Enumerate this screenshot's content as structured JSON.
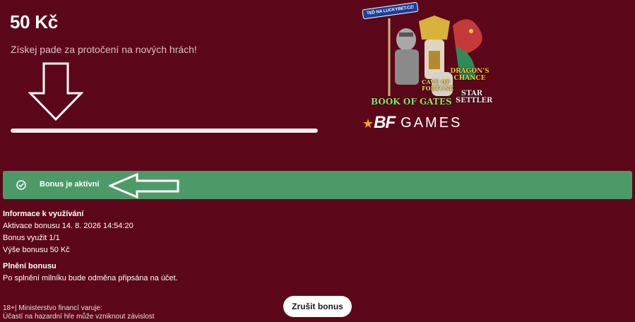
{
  "bonus": {
    "amount": "50 Kč",
    "subtitle": "Získej pade za protočení na nových hrách!",
    "progress_fraction": 1.0
  },
  "promo": {
    "badge": "TEĎ NA LUCKYBET.CZ!",
    "games": [
      "Book of Gates",
      "Cave of Fortune",
      "Dragon's Chance",
      "Star Settler"
    ],
    "logo_mark": "BF",
    "logo_text": "GAMES"
  },
  "status": {
    "label": "Bonus je aktivní"
  },
  "info": {
    "heading": "Informace k využívání",
    "activation": "Aktivace bonusu 14. 8. 2026 14:54:20",
    "used": "Bonus využit 1/1",
    "amount": "Výše bonusu 50 Kč"
  },
  "fulfilment": {
    "heading": "Plnění bonusu",
    "text": "Po splnění milníku bude odměna připsána na účet."
  },
  "cancel_label": "Zrušit bonus",
  "legal": {
    "line1": "18+| Ministerstvo financí varuje:",
    "line2": "Účastí na hazardní hře může vzniknout závislost"
  },
  "colors": {
    "background": "#5c0719",
    "status_bar": "#4d9a69",
    "progress": "#f4f0f0"
  }
}
